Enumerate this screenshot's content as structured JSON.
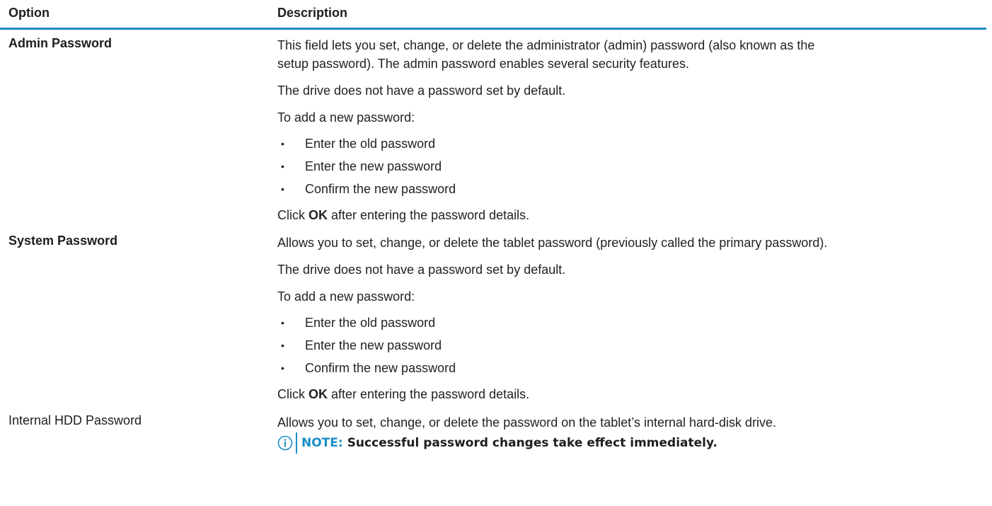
{
  "header": {
    "option": "Option",
    "description": "Description"
  },
  "rows": [
    {
      "option": "Admin Password",
      "intro_line1": "This field lets you set, change, or delete the administrator (admin) password (also known as the",
      "intro_line2": "setup password). The admin password enables several security features.",
      "default_text": "The drive does not have a password set by default.",
      "add_text": "To add a new password:",
      "bullets": [
        "Enter the old password",
        "Enter the new password",
        "Confirm the new password"
      ],
      "click_prefix": "Click ",
      "click_bold": "OK",
      "click_suffix": " after entering the password details."
    },
    {
      "option": "System Password",
      "intro_line1": "Allows you to set, change, or delete the tablet password (previously called the primary password).",
      "default_text": "The drive does not have a password set by default.",
      "add_text": "To add a new password:",
      "bullets": [
        "Enter the old password",
        "Enter the new password",
        "Confirm the new password"
      ],
      "click_prefix": "Click ",
      "click_bold": "OK",
      "click_suffix": " after entering the password details."
    },
    {
      "option": "Internal HDD Password",
      "intro_line1": "Allows you to set, change, or delete the password on the tablet’s internal hard-disk drive.",
      "note_label": "NOTE:",
      "note_text": "Successful password changes take effect immediately.",
      "note_icon": "info-icon"
    }
  ],
  "bullet_glyph": "•",
  "colors": {
    "accent": "#1a8ec9",
    "text": "#1e1e1e"
  }
}
